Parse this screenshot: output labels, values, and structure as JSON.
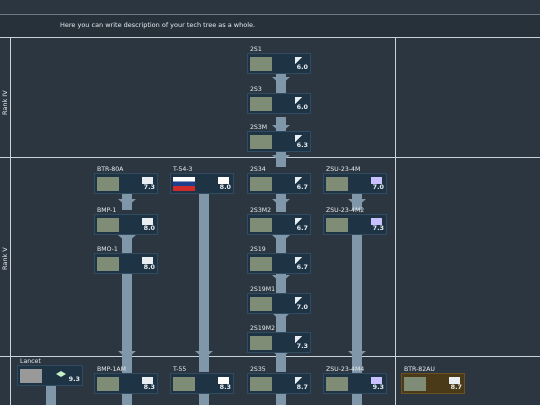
{
  "description": "Here you can write description of your tech tree as a whole.",
  "ranks": [
    {
      "label": "Rank IV"
    },
    {
      "label": "Rank V"
    }
  ],
  "vehicles": {
    "2S1": {
      "name": "2S1",
      "br": "6.0"
    },
    "2S3": {
      "name": "2S3",
      "br": "6.0"
    },
    "2S3M": {
      "name": "2S3M",
      "br": "6.3"
    },
    "BTR80A": {
      "name": "BTR-80A",
      "br": "7.3"
    },
    "T543": {
      "name": "T-54-3",
      "br": "8.0"
    },
    "2S34": {
      "name": "2S34",
      "br": "6.7"
    },
    "ZSU234M": {
      "name": "ZSU-23-4M",
      "br": "7.0"
    },
    "BMP1": {
      "name": "BMP-1",
      "br": "8.0"
    },
    "2S3M2": {
      "name": "2S3M2",
      "br": "6.7"
    },
    "ZSU234M2": {
      "name": "ZSU-23-4M2",
      "br": "7.3"
    },
    "BMO1": {
      "name": "BMO-1",
      "br": "8.0"
    },
    "2S19": {
      "name": "2S19",
      "br": "6.7"
    },
    "2S19M1": {
      "name": "2S19M1",
      "br": "7.0"
    },
    "2S19M2": {
      "name": "2S19M2",
      "br": "7.3"
    },
    "Lancet": {
      "name": "Lancet",
      "br": "9.3"
    },
    "BMP1AM": {
      "name": "BMP-1AM",
      "br": "8.3"
    },
    "T55": {
      "name": "T-55",
      "br": "8.3"
    },
    "2S35": {
      "name": "2S35",
      "br": "8.7"
    },
    "ZSU234M4": {
      "name": "ZSU-23-4M4",
      "br": "9.3"
    },
    "BTR82AU": {
      "name": "BTR-82AU",
      "br": "8.7"
    }
  }
}
